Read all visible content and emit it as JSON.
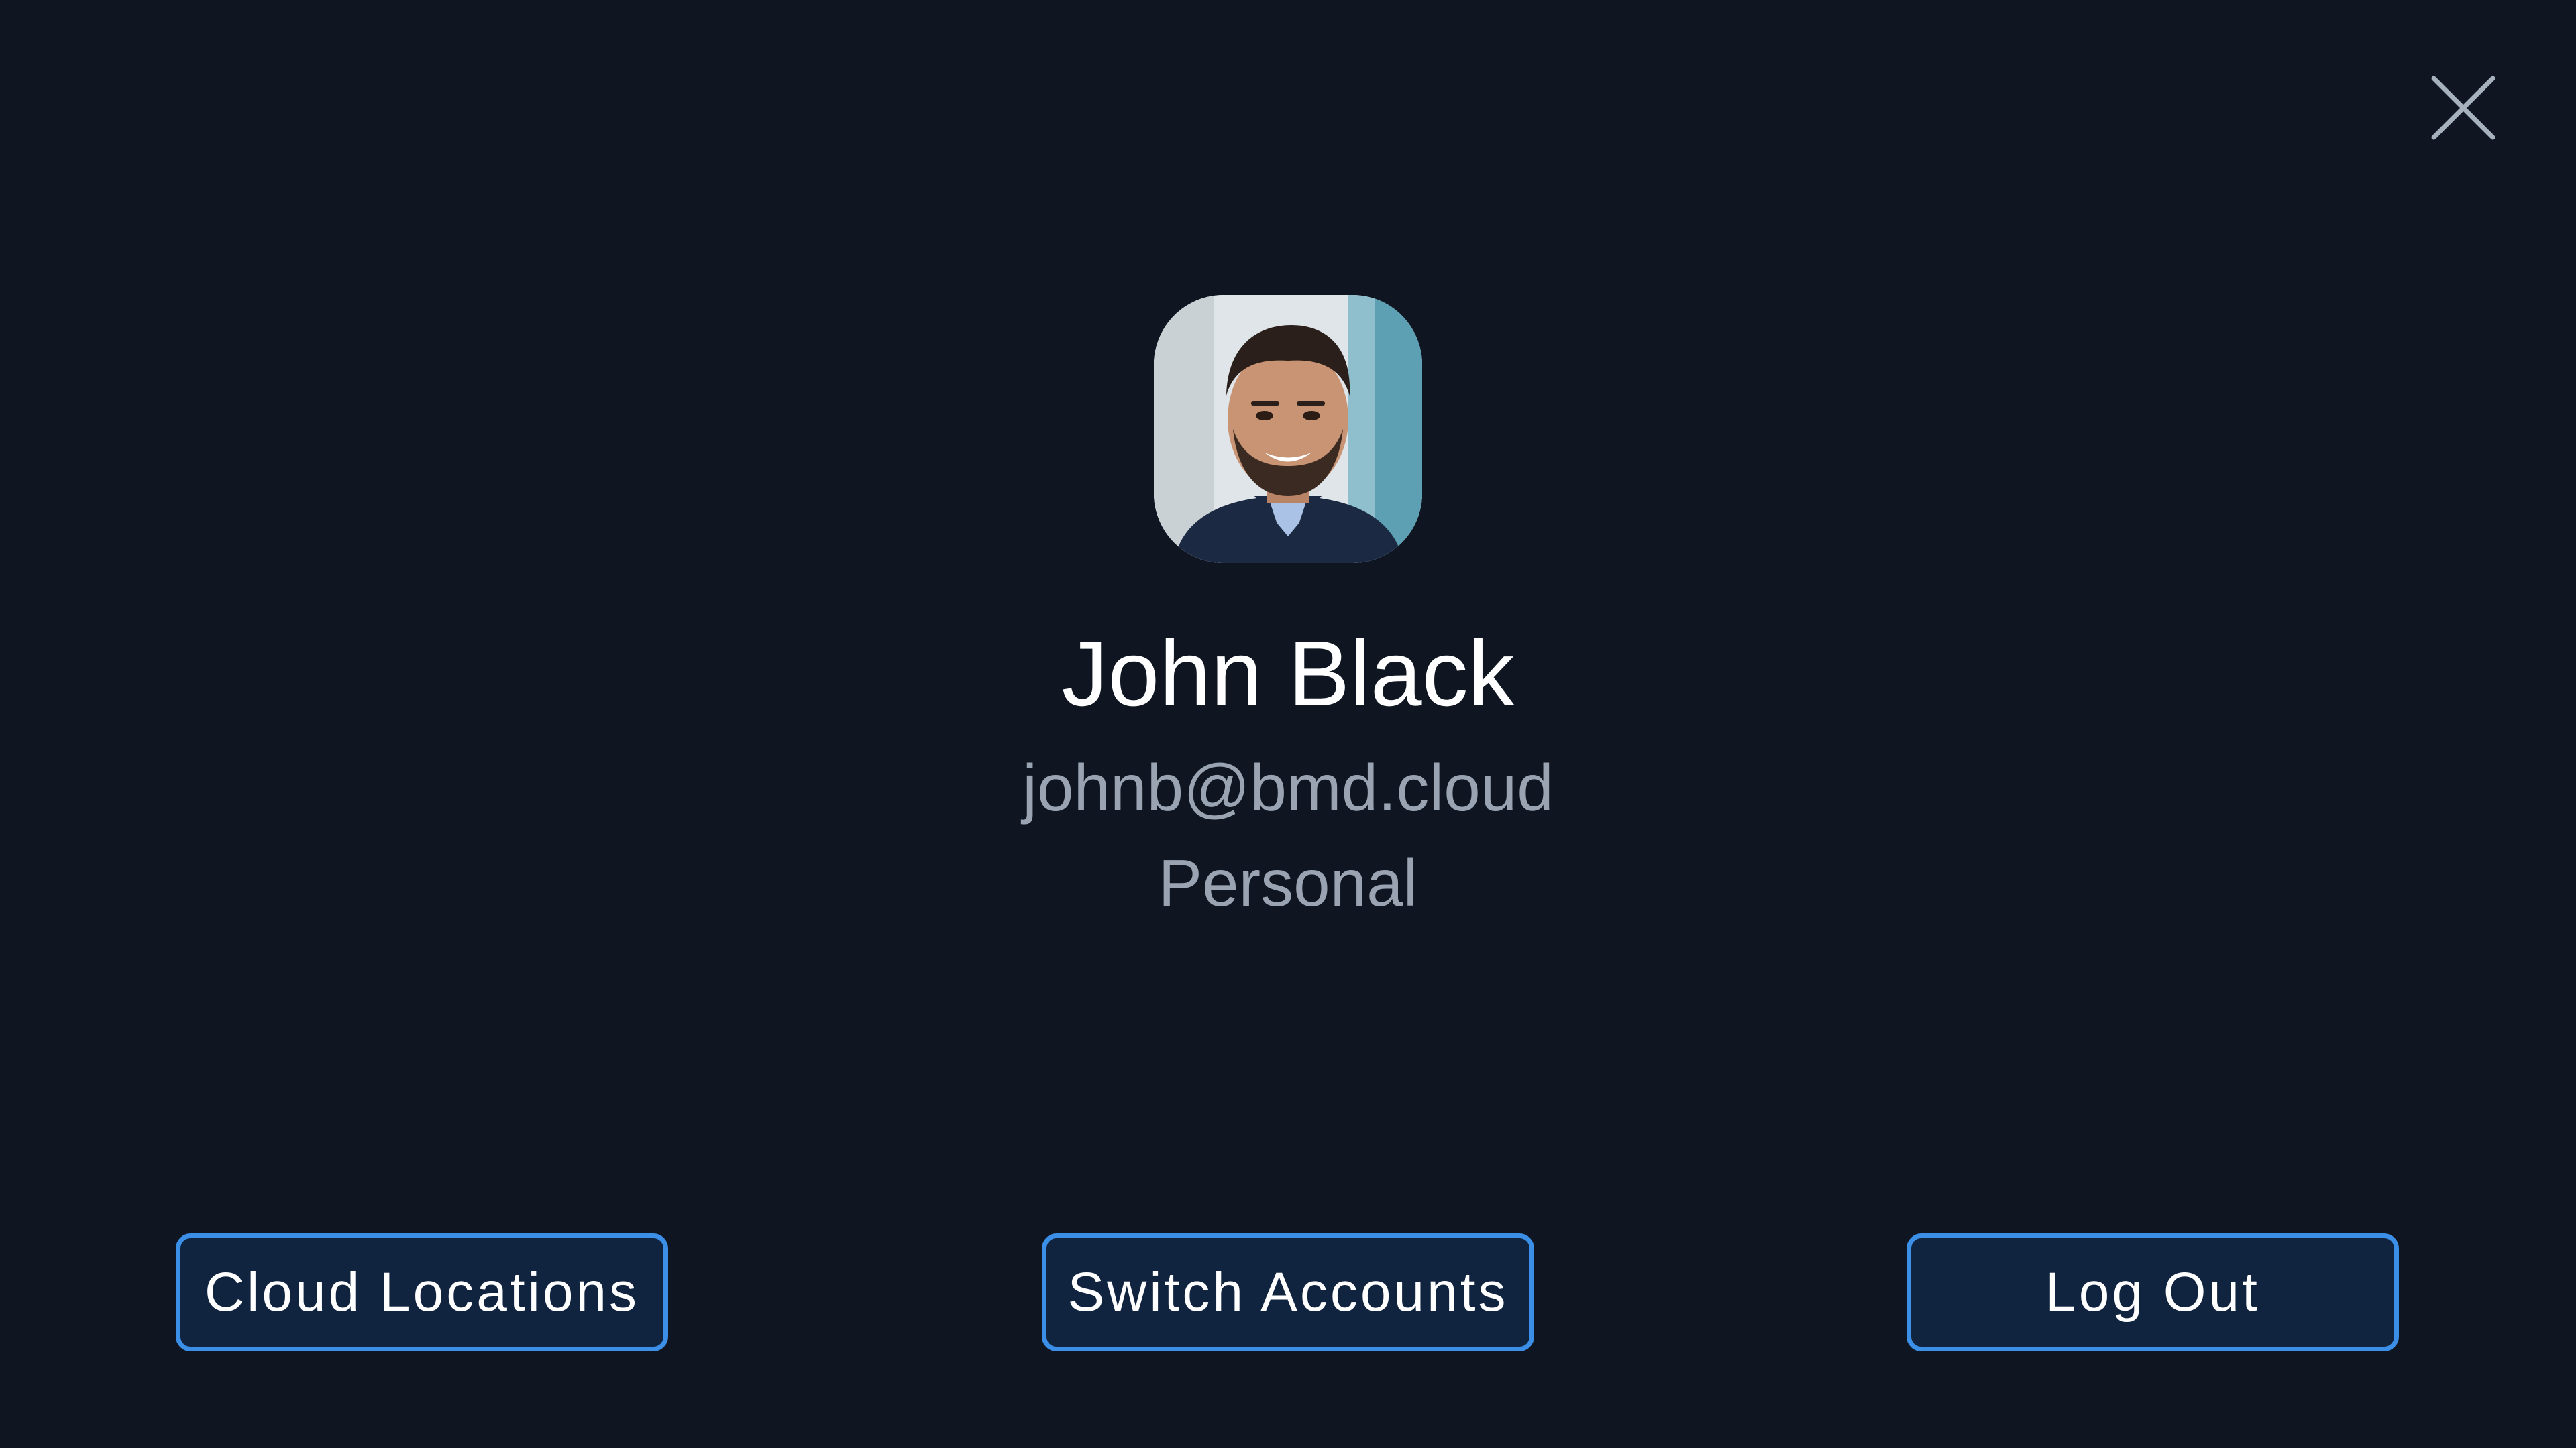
{
  "dialog": {
    "close_icon": "close-icon"
  },
  "profile": {
    "avatar_icon": "user-photo",
    "name": "John Black",
    "email": "johnb@bmd.cloud",
    "account_type": "Personal"
  },
  "actions": {
    "cloud_locations_label": "Cloud Locations",
    "switch_accounts_label": "Switch Accounts",
    "log_out_label": "Log Out"
  },
  "colors": {
    "background": "#0f1621",
    "button_border": "#3b8fe6",
    "button_fill": "#11243f",
    "secondary_text": "#9aa3b1"
  }
}
